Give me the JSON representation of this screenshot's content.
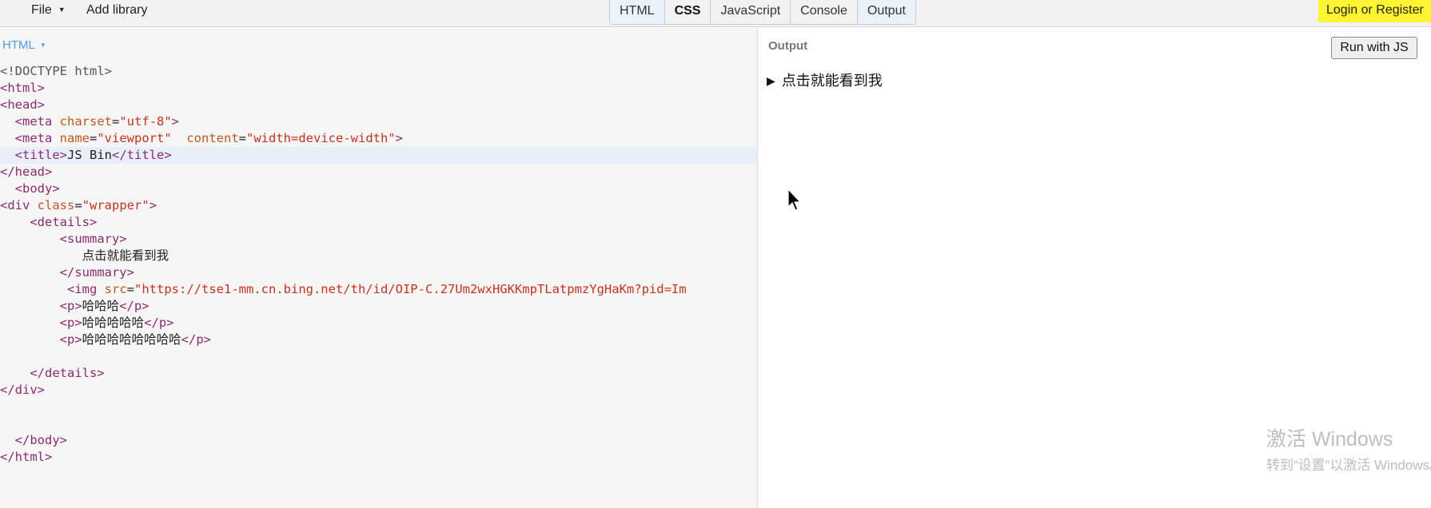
{
  "menu": {
    "file": "File",
    "add_library": "Add library",
    "login": "Login or Register"
  },
  "tabs": [
    "HTML",
    "CSS",
    "JavaScript",
    "Console",
    "Output"
  ],
  "editor": {
    "label": "HTML",
    "lines": [
      [
        [
          "d",
          "<!DOCTYPE html>"
        ]
      ],
      [
        [
          "t",
          "<html>"
        ]
      ],
      [
        [
          "t",
          "<head>"
        ]
      ],
      [
        [
          "",
          "  "
        ],
        [
          "t",
          "<meta "
        ],
        [
          "a",
          "charset"
        ],
        [
          "",
          "="
        ],
        [
          "s",
          "\"utf-8\""
        ],
        [
          "t",
          ">"
        ]
      ],
      [
        [
          "",
          "  "
        ],
        [
          "t",
          "<meta "
        ],
        [
          "a",
          "name"
        ],
        [
          "",
          "="
        ],
        [
          "s",
          "\"viewport\""
        ],
        [
          "",
          "  "
        ],
        [
          "a",
          "content"
        ],
        [
          "",
          "="
        ],
        [
          "s",
          "\"width=device-width\""
        ],
        [
          "t",
          ">"
        ]
      ],
      [
        [
          "",
          "  "
        ],
        [
          "t",
          "<title>"
        ],
        [
          "",
          "JS Bin"
        ],
        [
          "t",
          "</title>"
        ]
      ],
      [
        [
          "t",
          "</head>"
        ]
      ],
      [
        [
          "",
          "  "
        ],
        [
          "t",
          "<body>"
        ]
      ],
      [
        [
          "t",
          "<div "
        ],
        [
          "a",
          "class"
        ],
        [
          "",
          "="
        ],
        [
          "s",
          "\"wrapper\""
        ],
        [
          "t",
          ">"
        ]
      ],
      [
        [
          "",
          "    "
        ],
        [
          "t",
          "<details>"
        ]
      ],
      [
        [
          "",
          "        "
        ],
        [
          "t",
          "<summary>"
        ]
      ],
      [
        [
          "",
          "           点击就能看到我"
        ]
      ],
      [
        [
          "",
          "        "
        ],
        [
          "t",
          "</summary>"
        ]
      ],
      [
        [
          "",
          "         "
        ],
        [
          "t",
          "<img "
        ],
        [
          "a",
          "src"
        ],
        [
          "",
          "="
        ],
        [
          "s",
          "\"https://tse1-mm.cn.bing.net/th/id/OIP-C.27Um2wxHGKKmpTLatpmzYgHaKm?pid=Im"
        ]
      ],
      [
        [
          "",
          "        "
        ],
        [
          "t",
          "<p>"
        ],
        [
          "",
          "哈哈哈"
        ],
        [
          "t",
          "</p>"
        ]
      ],
      [
        [
          "",
          "        "
        ],
        [
          "t",
          "<p>"
        ],
        [
          "",
          "哈哈哈哈哈"
        ],
        [
          "t",
          "</p>"
        ]
      ],
      [
        [
          "",
          "        "
        ],
        [
          "t",
          "<p>"
        ],
        [
          "",
          "哈哈哈哈哈哈哈哈"
        ],
        [
          "t",
          "</p>"
        ]
      ],
      [
        [
          "",
          ""
        ]
      ],
      [
        [
          "",
          "    "
        ],
        [
          "t",
          "</details>"
        ]
      ],
      [
        [
          "t",
          "</div>"
        ]
      ],
      [
        [
          "",
          ""
        ]
      ],
      [
        [
          "",
          ""
        ]
      ],
      [
        [
          "",
          "  "
        ],
        [
          "t",
          "</body>"
        ]
      ],
      [
        [
          "t",
          "</html>"
        ]
      ]
    ]
  },
  "output": {
    "label": "Output",
    "run_button": "Run with JS",
    "summary_text": "点击就能看到我"
  },
  "watermark": {
    "line1": "激活 Windows",
    "line2": "转到“设置”以激活 Windows。"
  },
  "colors": {
    "login_bg": "#fff533",
    "tag": "#8b2a6f",
    "attr": "#c0581e",
    "string": "#c4321f",
    "pane_label": "#4d9de0"
  }
}
